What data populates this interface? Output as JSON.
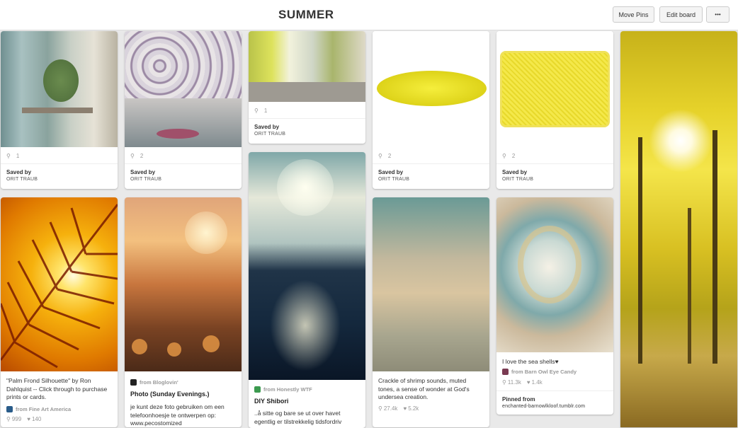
{
  "board": {
    "title": "SUMMER",
    "move_pins": "Move Pins",
    "edit_board": "Edit board",
    "more": "•••"
  },
  "pins": {
    "p1": {
      "repins": "1",
      "saved_label": "Saved by",
      "saved_by": "ORIT TRAUB"
    },
    "p2": {
      "repins": "2",
      "saved_label": "Saved by",
      "saved_by": "ORIT TRAUB"
    },
    "p3": {
      "repins": "1",
      "saved_label": "Saved by",
      "saved_by": "ORIT TRAUB"
    },
    "p4": {
      "repins": "2",
      "saved_label": "Saved by",
      "saved_by": "ORIT TRAUB"
    },
    "p5": {
      "repins": "2",
      "saved_label": "Saved by",
      "saved_by": "ORIT TRAUB"
    },
    "p7": {
      "desc": "\"Palm Frond Silhouette\" by Ron Dahlquist -- Click through to purchase prints or cards.",
      "source": "from Fine Art America",
      "repins": "999",
      "likes": "140"
    },
    "p8": {
      "source": "from Bloglovin'",
      "title": "Photo (Sunday Evenings.)",
      "desc": "je kunt deze foto gebruiken om een telefoonhoesje te ontwerpen op: www.pecostomized"
    },
    "p9": {
      "source": "from Honestly WTF",
      "title": "DIY Shibori",
      "desc": "..å sitte og bare se ut over havet egentlig er tilstrekkelig tidsfordriv"
    },
    "p10": {
      "desc": "Crackle of shrimp sounds, muted tones, a sense of wonder at God's undersea creation.",
      "repins": "27.4k",
      "likes": "5.2k"
    },
    "p11": {
      "desc": "I love the sea shells♥",
      "source": "from Barn Owl Eye Candy",
      "repins": "11.3k",
      "likes": "1.4k",
      "pinned_label": "Pinned from",
      "pinned_from": "enchanted-barnowlkloof.tumblr.com"
    }
  }
}
